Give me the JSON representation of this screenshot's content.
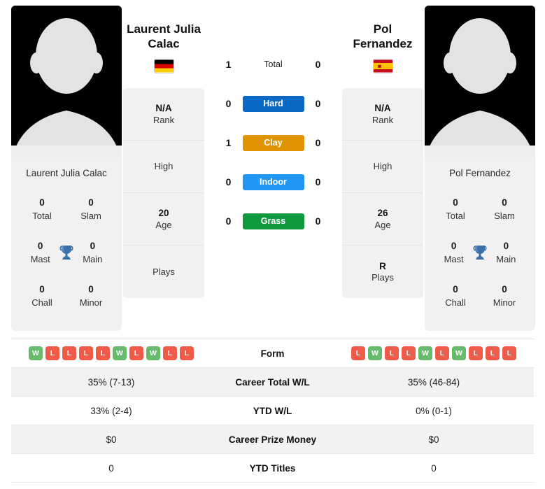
{
  "players": {
    "left": {
      "name": "Laurent Julia Calac",
      "name_line1": "Laurent Julia",
      "name_line2": "Calac",
      "flag": "de-flag-icon",
      "card_name": "Laurent Julia Calac",
      "titles": [
        {
          "value": "0",
          "label": "Total"
        },
        {
          "value": "0",
          "label": "Slam"
        },
        {
          "value": "0",
          "label": "Mast"
        },
        {
          "value": "0",
          "label": "Main"
        },
        {
          "value": "0",
          "label": "Chall"
        },
        {
          "value": "0",
          "label": "Minor"
        }
      ],
      "info": [
        {
          "value": "N/A",
          "label": "Rank"
        },
        {
          "value": "",
          "label": "High"
        },
        {
          "value": "20",
          "label": "Age"
        },
        {
          "value": "",
          "label": "Plays"
        }
      ],
      "form": [
        "W",
        "L",
        "L",
        "L",
        "L",
        "W",
        "L",
        "W",
        "L",
        "L"
      ],
      "career_total_wl": "35% (7-13)",
      "ytd_wl": "33% (2-4)",
      "career_prize_money": "$0",
      "ytd_titles": "0"
    },
    "right": {
      "name": "Pol Fernandez",
      "name_line1": "Pol",
      "name_line2": "Fernandez",
      "flag": "es-flag-icon",
      "card_name": "Pol Fernandez",
      "titles": [
        {
          "value": "0",
          "label": "Total"
        },
        {
          "value": "0",
          "label": "Slam"
        },
        {
          "value": "0",
          "label": "Mast"
        },
        {
          "value": "0",
          "label": "Main"
        },
        {
          "value": "0",
          "label": "Chall"
        },
        {
          "value": "0",
          "label": "Minor"
        }
      ],
      "info": [
        {
          "value": "N/A",
          "label": "Rank"
        },
        {
          "value": "",
          "label": "High"
        },
        {
          "value": "26",
          "label": "Age"
        },
        {
          "value": "R",
          "label": "Plays"
        }
      ],
      "form": [
        "L",
        "W",
        "L",
        "L",
        "W",
        "L",
        "W",
        "L",
        "L",
        "L"
      ],
      "career_total_wl": "35% (46-84)",
      "ytd_wl": "0% (0-1)",
      "career_prize_money": "$0",
      "ytd_titles": "0"
    }
  },
  "h2h": [
    {
      "label": "Total",
      "left": "1",
      "right": "0",
      "type": "text",
      "color": ""
    },
    {
      "label": "Hard",
      "left": "0",
      "right": "0",
      "type": "pill",
      "color": "#0a69c4"
    },
    {
      "label": "Clay",
      "left": "1",
      "right": "0",
      "type": "pill",
      "color": "#e09404"
    },
    {
      "label": "Indoor",
      "left": "0",
      "right": "0",
      "type": "pill",
      "color": "#2196f3"
    },
    {
      "label": "Grass",
      "left": "0",
      "right": "0",
      "type": "pill",
      "color": "#119a3d"
    }
  ],
  "table_rows": [
    {
      "label": "Form",
      "type": "form"
    },
    {
      "label": "Career Total W/L",
      "type": "text",
      "left": "35% (7-13)",
      "right": "35% (46-84)"
    },
    {
      "label": "YTD W/L",
      "type": "text",
      "left": "33% (2-4)",
      "right": "0% (0-1)"
    },
    {
      "label": "Career Prize Money",
      "type": "text",
      "left": "$0",
      "right": "$0"
    },
    {
      "label": "YTD Titles",
      "type": "text",
      "left": "0",
      "right": "0"
    }
  ],
  "colors": {
    "win_badge": "#68bb6c",
    "loss_badge": "#ef5a49",
    "trophy": "#3b6fa8",
    "card_bg": "#f1f1f1",
    "row_alt": "#f2f2f2"
  }
}
